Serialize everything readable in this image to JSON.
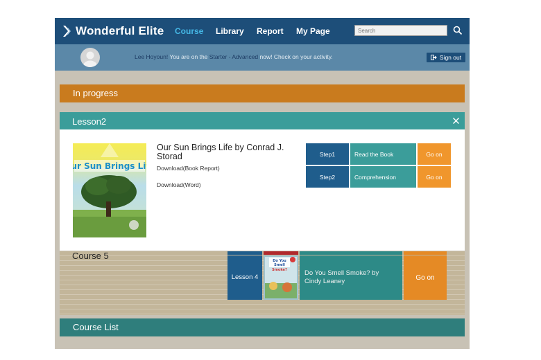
{
  "brand": {
    "name": "Wonderful Elite"
  },
  "nav": {
    "items": [
      {
        "label": "Course",
        "active": true
      },
      {
        "label": "Library",
        "active": false
      },
      {
        "label": "Report",
        "active": false
      },
      {
        "label": "My Page",
        "active": false
      }
    ],
    "search_placeholder": "Search"
  },
  "userbar": {
    "name": "Lee Hoyoun!",
    "text_before_level": " You are on the ",
    "level": "Starter - Advanced",
    "text_after_level": " now! Check on your activity.",
    "signout_label": "Sign out"
  },
  "sections": {
    "in_progress": "In progress",
    "course_list": "Course List"
  },
  "course": {
    "title": "Course 5",
    "lesson_label": "Lesson 4",
    "lesson_title": "Do You Smell Smoke? by Cindy Leaney",
    "go_label": "Go on",
    "thumb_text": "Do You Smell Smoke?"
  },
  "modal": {
    "title": "Lesson2",
    "book_title": "Our Sun Brings Life by Conrad J. Storad",
    "cover_text": "Our Sun Brings Life",
    "download_report": "Download(Book Report)",
    "download_word": "Download(Word)",
    "steps": [
      {
        "label": "Step1",
        "name": "Read the Book",
        "action": "Go on"
      },
      {
        "label": "Step2",
        "name": "Comprehension",
        "action": "Go on"
      }
    ]
  },
  "colors": {
    "nav_bg": "#1d4e79",
    "nav_active": "#45b8e6",
    "userbar_bg": "#5b88a8",
    "in_progress_bg": "#c97b1e",
    "teal": "#3b9d9a",
    "step_blue": "#1f5d8c",
    "go_orange": "#f0962c"
  }
}
